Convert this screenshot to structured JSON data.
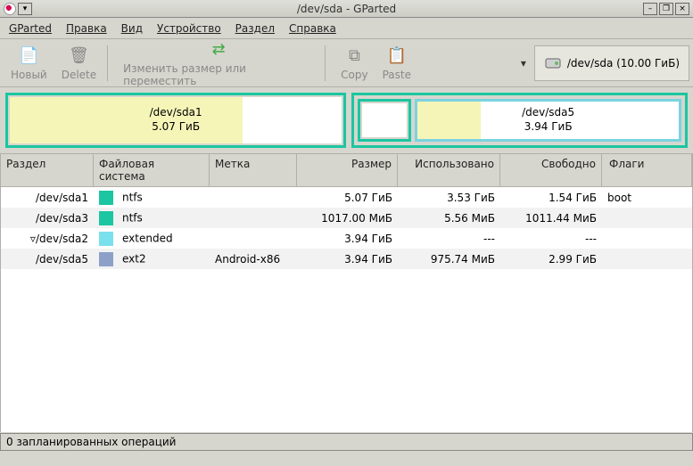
{
  "window": {
    "title": "/dev/sda - GParted"
  },
  "menu": {
    "gparted": "GParted",
    "edit": "Правка",
    "view": "Вид",
    "device": "Устройство",
    "partition": "Раздел",
    "help": "Справка"
  },
  "toolbar": {
    "new": "Новый",
    "delete": "Delete",
    "resize": "Изменить размер или переместить",
    "copy": "Copy",
    "paste": "Paste"
  },
  "device_selector": {
    "label": "/dev/sda   (10.00 ГиБ)"
  },
  "diskmap": {
    "sda1": {
      "name": "/dev/sda1",
      "size": "5.07 ГиБ"
    },
    "sda5": {
      "name": "/dev/sda5",
      "size": "3.94 ГиБ"
    }
  },
  "columns": {
    "partition": "Раздел",
    "fs": "Файловая система",
    "label": "Метка",
    "size": "Размер",
    "used": "Использовано",
    "free": "Свободно",
    "flags": "Флаги"
  },
  "rows": [
    {
      "partition": "/dev/sda1",
      "swatch": "sw-ntfs",
      "fs": "ntfs",
      "label": "",
      "size": "5.07 ГиБ",
      "used": "3.53 ГиБ",
      "free": "1.54 ГиБ",
      "flags": "boot",
      "indent": 1
    },
    {
      "partition": "/dev/sda3",
      "swatch": "sw-ntfs",
      "fs": "ntfs",
      "label": "",
      "size": "1017.00 МиБ",
      "used": "5.56 МиБ",
      "free": "1011.44 МиБ",
      "flags": "",
      "indent": 1
    },
    {
      "partition": "/dev/sda2",
      "swatch": "sw-extended",
      "fs": "extended",
      "label": "",
      "size": "3.94 ГиБ",
      "used": "---",
      "free": "---",
      "flags": "",
      "indent": 0,
      "expander": "▿"
    },
    {
      "partition": "/dev/sda5",
      "swatch": "sw-ext2",
      "fs": "ext2",
      "label": "Android-x86",
      "size": "3.94 ГиБ",
      "used": "975.74 МиБ",
      "free": "2.99 ГиБ",
      "flags": "",
      "indent": 2
    }
  ],
  "statusbar": {
    "text": "0 запланированных операций"
  }
}
